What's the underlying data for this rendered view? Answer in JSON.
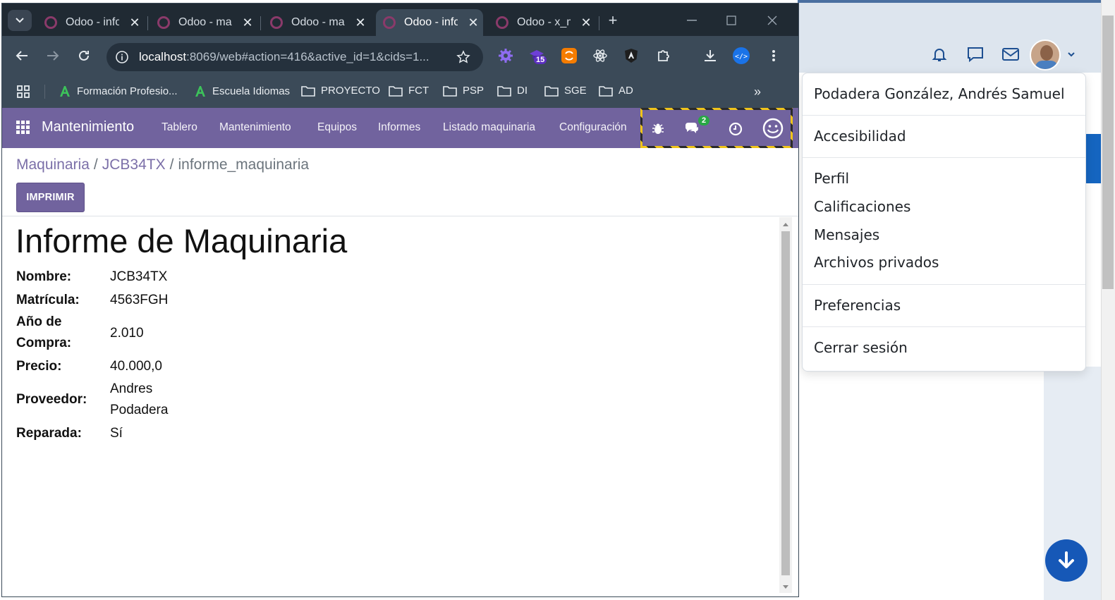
{
  "browser": {
    "tabs": [
      {
        "title": "Odoo - info",
        "active": false
      },
      {
        "title": "Odoo - ma",
        "active": false
      },
      {
        "title": "Odoo - ma",
        "active": false
      },
      {
        "title": "Odoo - info",
        "active": true
      },
      {
        "title": "Odoo - x_m",
        "active": false
      }
    ],
    "url_host": "localhost",
    "url_path": ":8069/web#action=416&active_id=1&cids=1...",
    "extension_badge": "15",
    "bookmarks": [
      {
        "label": "Formación Profesio...",
        "icon": "green-a-icon"
      },
      {
        "label": "Escuela Idiomas",
        "icon": "green-a-icon"
      },
      {
        "label": "PROYECTO",
        "icon": "folder-icon"
      },
      {
        "label": "FCT",
        "icon": "folder-icon"
      },
      {
        "label": "PSP",
        "icon": "folder-icon"
      },
      {
        "label": "DI",
        "icon": "folder-icon"
      },
      {
        "label": "SGE",
        "icon": "folder-icon"
      },
      {
        "label": "AD",
        "icon": "folder-icon"
      }
    ]
  },
  "odoo": {
    "app_name": "Mantenimiento",
    "menu": [
      "Tablero",
      "Mantenimiento",
      "Equipos",
      "Informes",
      "Listado maquinaria",
      "Configuración"
    ],
    "messages_count": "2",
    "breadcrumb": [
      "Maquinaria",
      "JCB34TX",
      "informe_maquinaria"
    ],
    "print_label": "IMPRIMIR",
    "accent": "#71639e"
  },
  "report": {
    "title": "Informe de Maquinaria",
    "fields": [
      {
        "label": "Nombre:",
        "value": "JCB34TX"
      },
      {
        "label": "Matrícula:",
        "value": "4563FGH"
      },
      {
        "label": "Año de Compra:",
        "value": "2.010"
      },
      {
        "label": "Precio:",
        "value": "40.000,0"
      },
      {
        "label": "Proveedor:",
        "value": "Andres Podadera"
      },
      {
        "label": "Reparada:",
        "value": "Sí"
      }
    ]
  },
  "user_menu": {
    "user_name": "Podadera González, Andrés Samuel",
    "items": [
      "Accesibilidad",
      "Perfil",
      "Calificaciones",
      "Mensajes",
      "Archivos privados",
      "Preferencias",
      "Cerrar sesión"
    ]
  }
}
